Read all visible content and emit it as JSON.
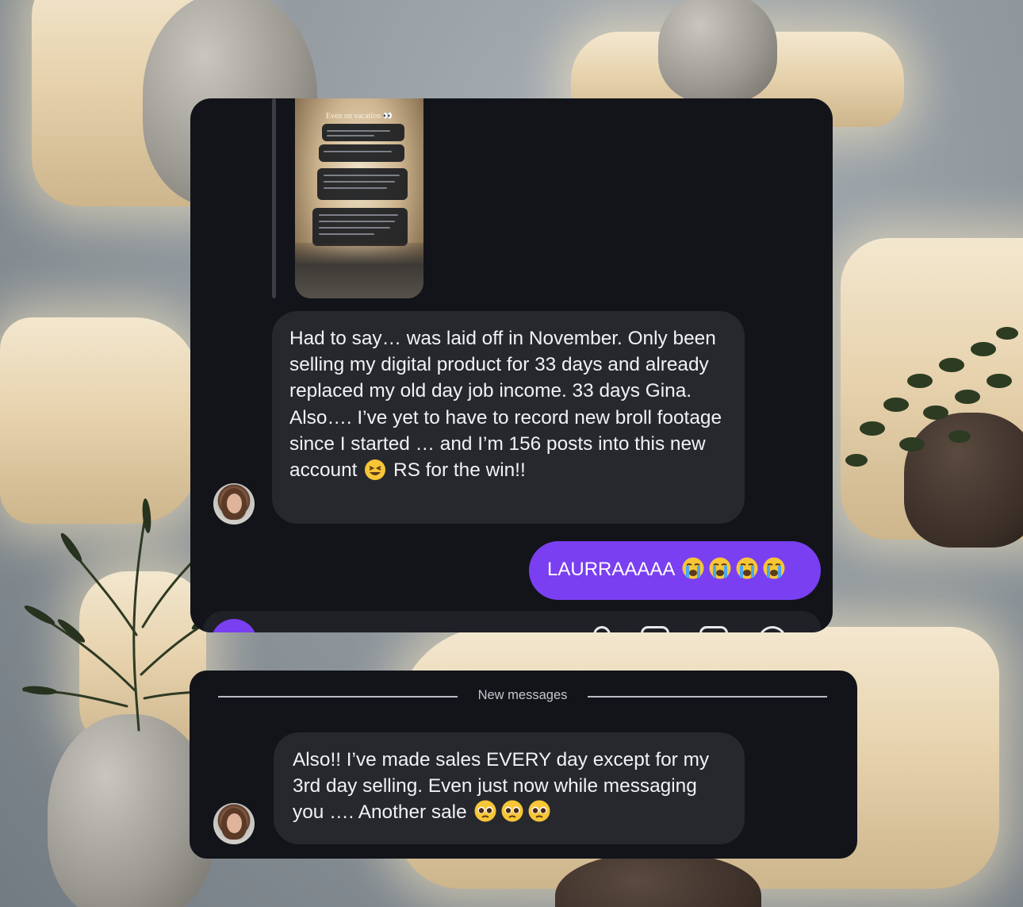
{
  "story": {
    "title": "Even on vacation 👀"
  },
  "messages": [
    {
      "sender": "them",
      "text": "Had to say… was laid off in November. Only been selling my digital product for 33 days and already replaced my old day job income. 33 days Gina. Also…. I’ve yet to have to record new broll footage since I started … and I’m 156 posts into this new account",
      "emoji_after": "😆",
      "text_end": "RS for the win!!"
    },
    {
      "sender": "me",
      "text": "LAURRAAAAA",
      "emojis": [
        "😭",
        "😭",
        "😭",
        "😭"
      ]
    }
  ],
  "divider": {
    "label": "New messages"
  },
  "new_messages": [
    {
      "sender": "them",
      "text": "Also!! I’ve made sales EVERY day except for my 3rd day selling. Even just now while messaging you …. Another sale",
      "emojis": [
        "🥺",
        "🥺",
        "🥺"
      ]
    }
  ],
  "composer": {
    "icons": [
      "camera-icon",
      "microphone-icon",
      "image-icon",
      "sticker-icon",
      "emoji-icon"
    ]
  },
  "colors": {
    "panel_background": "#12141a",
    "incoming_bubble": "#26282e",
    "outgoing_bubble": "#7a3ff0",
    "text": "#f2f2f4"
  }
}
